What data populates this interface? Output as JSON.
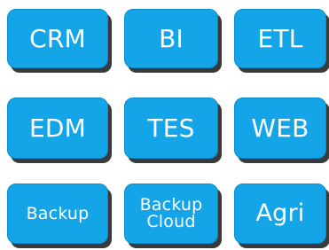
{
  "tiles": [
    {
      "id": "crm",
      "label": "CRM"
    },
    {
      "id": "bi",
      "label": "BI"
    },
    {
      "id": "etl",
      "label": "ETL"
    },
    {
      "id": "edm",
      "label": "EDM"
    },
    {
      "id": "tes",
      "label": "TES"
    },
    {
      "id": "web",
      "label": "WEB"
    },
    {
      "id": "backup",
      "label": "Backup"
    },
    {
      "id": "backup-cloud",
      "label": "Backup\nCloud"
    },
    {
      "id": "agri",
      "label": "Agri"
    }
  ],
  "colors": {
    "tile_fill": "#14a4e8",
    "tile_shadow": "#3a3a3a",
    "tile_text": "#ffffff"
  }
}
